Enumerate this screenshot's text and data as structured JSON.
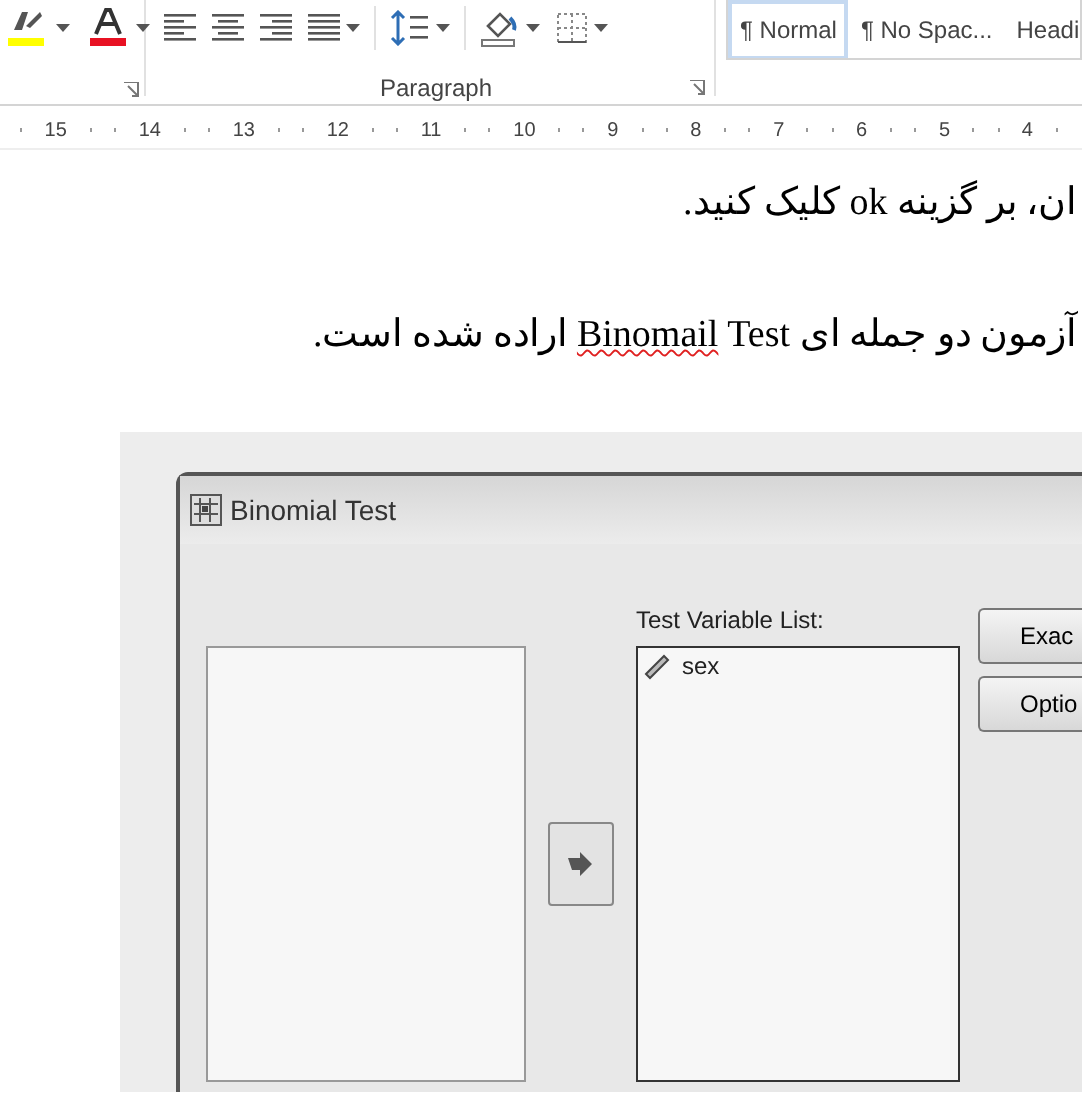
{
  "ribbon": {
    "font_tools": [
      {
        "kind": "highlight",
        "color": "#ffff00"
      },
      {
        "kind": "font-color",
        "color": "#e81123"
      }
    ],
    "paragraph_tools": [
      {
        "kind": "align-left"
      },
      {
        "kind": "align-center"
      },
      {
        "kind": "align-right"
      },
      {
        "kind": "justify"
      },
      {
        "kind": "line-spacing"
      },
      {
        "kind": "shading"
      },
      {
        "kind": "borders"
      }
    ],
    "group_label": "Paragraph",
    "styles": [
      {
        "label": "¶ Normal",
        "selected": true
      },
      {
        "label": "¶ No Spac...",
        "selected": false
      },
      {
        "label": "Headi",
        "selected": false
      }
    ]
  },
  "ruler": [
    "15",
    "14",
    "13",
    "12",
    "11",
    "10",
    "9",
    "8",
    "7",
    "6",
    "5",
    "4"
  ],
  "document": {
    "paragraphs": [
      [
        {
          "text": "ان، بر گزینه ok کلیک کنید.",
          "misspelled": false
        }
      ],
      [
        {
          "text": "آزمون دو جمله ای ",
          "misspelled": false
        },
        {
          "text": "Binomail",
          "misspelled": true
        },
        {
          "text": " Test اراده شده است.",
          "misspelled": false
        }
      ]
    ],
    "dialog": {
      "title": "Binomial Test",
      "list_label": "Test Variable List:",
      "variables": [
        "sex"
      ],
      "buttons": [
        "Exac",
        "Optio"
      ]
    }
  }
}
